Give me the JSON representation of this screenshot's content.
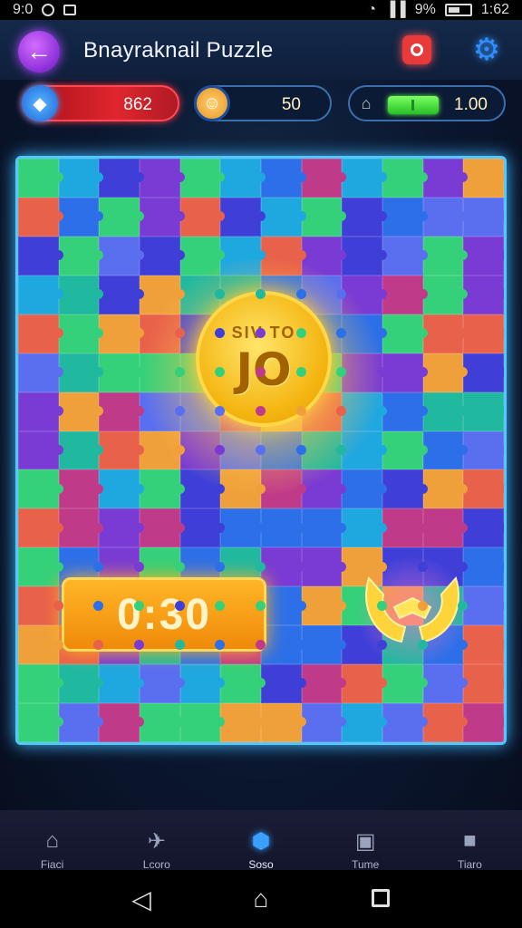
{
  "status_bar": {
    "time": "9:0",
    "right_text": "9%",
    "clock": "1:62"
  },
  "header": {
    "title": "Bnayraknail Puzzle",
    "back_icon": "back-arrow-icon",
    "red_icon": "record-icon",
    "gear_icon": "gear-icon"
  },
  "stats": {
    "gems": {
      "value": "862",
      "icon": "gem-icon"
    },
    "coins": {
      "value": "50",
      "icon": "face-icon"
    },
    "energy": {
      "value": "1.00",
      "icon": "lock-icon",
      "level": 1.0
    }
  },
  "board": {
    "coin_top": "SIV TO",
    "coin_value": "JO",
    "timer": "0:30",
    "emblem_icon": "horns-emblem-icon",
    "palette": [
      "#2d6fe8",
      "#3f3fd8",
      "#7a3ad4",
      "#21b8a0",
      "#35d07a",
      "#1fa7e0",
      "#e8614a",
      "#f0a03a",
      "#c03a8a",
      "#5a6ef0"
    ]
  },
  "nav": {
    "items": [
      {
        "label": "Fiaci",
        "icon": "home-icon",
        "active": false
      },
      {
        "label": "Lcoro",
        "icon": "plane-icon",
        "active": false
      },
      {
        "label": "Soso",
        "icon": "gem-icon",
        "active": true
      },
      {
        "label": "Tume",
        "icon": "briefcase-icon",
        "active": false
      },
      {
        "label": "Tiaro",
        "icon": "square-icon",
        "active": false
      }
    ]
  }
}
